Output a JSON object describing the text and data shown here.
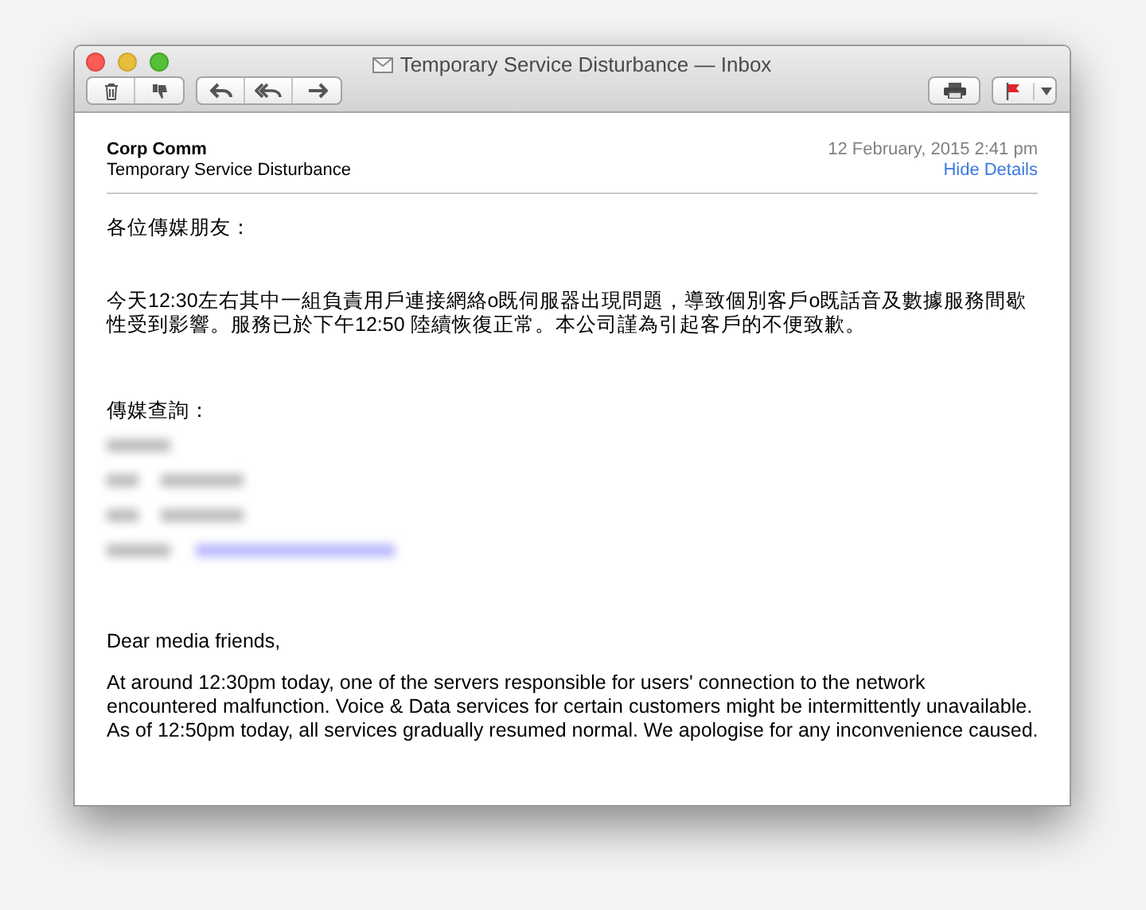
{
  "window": {
    "title": "Temporary Service Disturbance — Inbox"
  },
  "header": {
    "sender": "Corp Comm",
    "subject": "Temporary Service Disturbance",
    "date": "12 February, 2015 2:41 pm",
    "details_link": "Hide Details"
  },
  "body": [
    {
      "kind": "text",
      "text": "各位傳媒朋友："
    },
    {
      "kind": "text",
      "text": "今天12:30左右其中一組負責用戶連接網絡o既伺服器出現問題，導致個別客戶o既話音及數據服務間歇性受到影響。服務已於下午12:50 陸續恢復正常。本公司謹為引起客戶的不便致歉。"
    },
    {
      "kind": "text",
      "text": "傳媒查詢："
    },
    {
      "kind": "blurred"
    },
    {
      "kind": "text",
      "text": "Dear media friends,"
    },
    {
      "kind": "text",
      "text": "At around 12:30pm today, one of the servers responsible for users' connection to the network encountered malfunction.  Voice & Data services for certain customers might be intermittently unavailable.  As of 12:50pm today, all services gradually resumed normal.  We apologise for any inconvenience caused."
    }
  ]
}
